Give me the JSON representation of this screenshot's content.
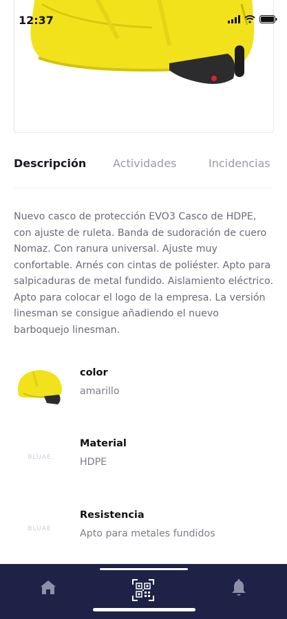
{
  "status_bar": {
    "time": "12:37"
  },
  "tabs": [
    {
      "label": "Descripción",
      "active": true
    },
    {
      "label": "Actividades",
      "active": false
    },
    {
      "label": "Incidencias",
      "active": false
    }
  ],
  "description": "Nuevo casco de protección EVO3 Casco de HDPE, con ajuste de ruleta. Banda de sudoración de cuero Nomaz. Con ranura universal. Ajuste muy confortable. Arnés con cintas de poliéster. Apto para salpicaduras de metal fundido. Aislamiento eléctrico. Apto para colocar el logo de la empresa. La versión linesman se consigue añadiendo el nuevo barboquejo linesman.",
  "attributes": [
    {
      "label": "color",
      "value": "amarillo",
      "thumb": "helmet"
    },
    {
      "label": "Material",
      "value": "HDPE",
      "thumb": "logo",
      "logo_text": "BLUAE"
    },
    {
      "label": "Resistencia",
      "value": "Apto para metales fundidos",
      "thumb": "logo",
      "logo_text": "BLUAE"
    }
  ],
  "nav": {
    "items": [
      "home-icon",
      "qr-scan-icon",
      "bell-icon"
    ]
  },
  "colors": {
    "helmet": "#f2e21b",
    "nav_bg": "#1e2247"
  }
}
